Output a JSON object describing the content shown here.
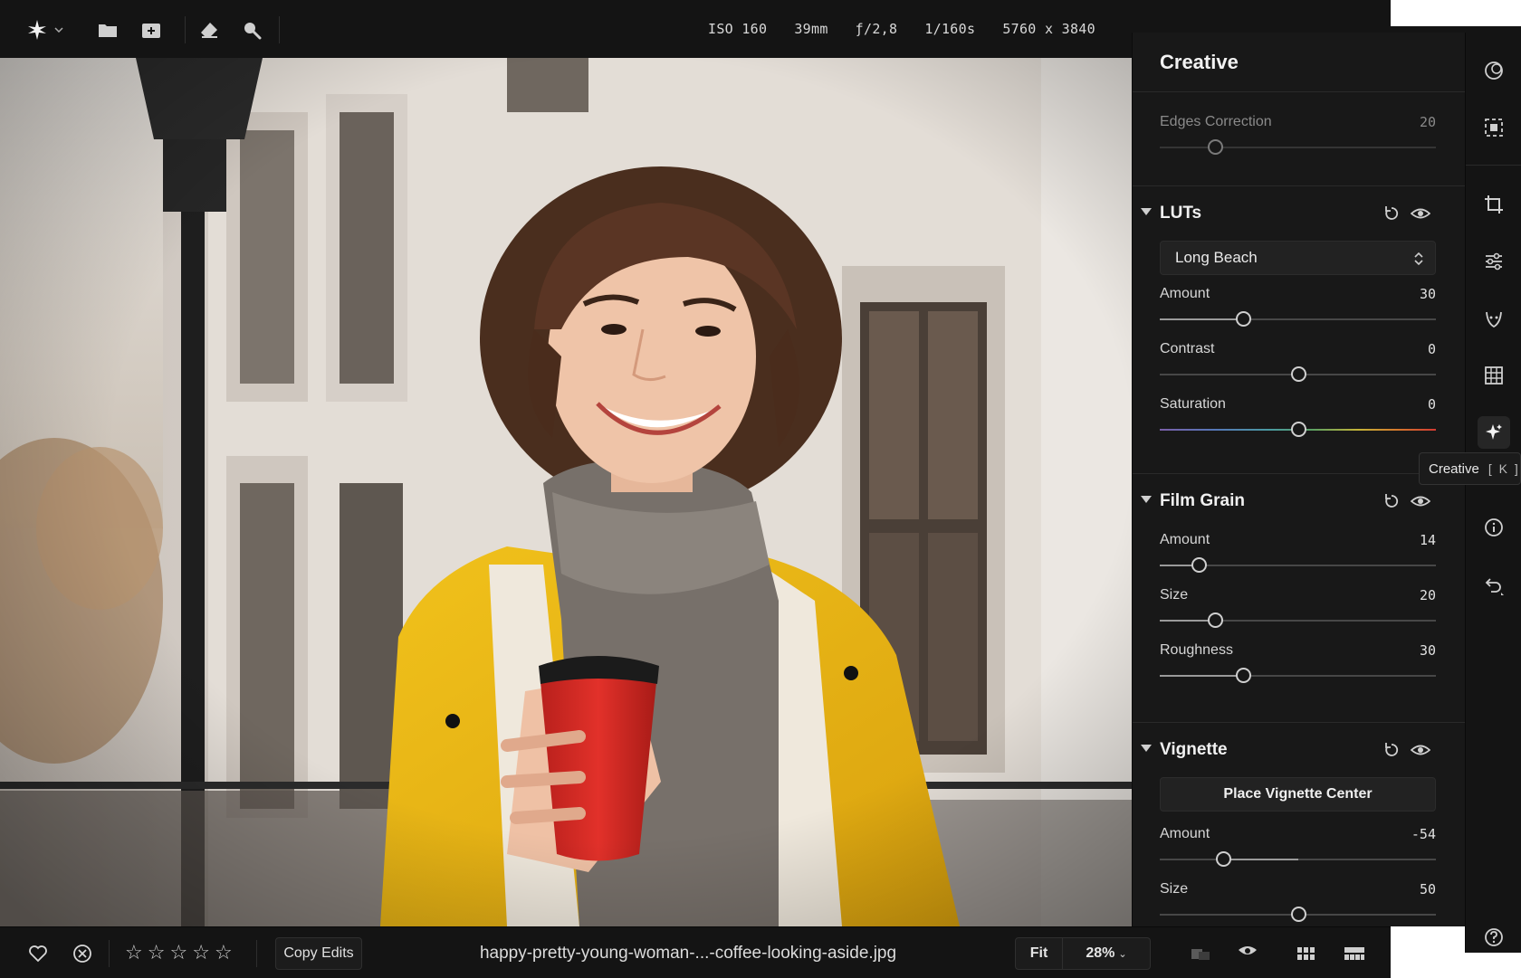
{
  "toolbar": {
    "icons": [
      "app-logo-sparkle-icon",
      "chevron-down-icon",
      "folder-icon",
      "add-image-icon",
      "eraser-icon",
      "zoom-icon"
    ],
    "exif": {
      "iso": "ISO 160",
      "focal": "39mm",
      "aperture": "ƒ/2,8",
      "shutter": "1/160s",
      "dimensions": "5760 x 3840"
    }
  },
  "panel": {
    "title": "Creative",
    "edges": {
      "label": "Edges Correction",
      "value": "20",
      "level": 0.2
    },
    "luts": {
      "title": "LUTs",
      "preset": "Long Beach",
      "sliders": [
        {
          "label": "Amount",
          "value": "30",
          "level": 0.3
        },
        {
          "label": "Contrast",
          "value": "0",
          "level": 0.5
        },
        {
          "label": "Saturation",
          "value": "0",
          "level": 0.5
        }
      ]
    },
    "film_grain": {
      "title": "Film Grain",
      "sliders": [
        {
          "label": "Amount",
          "value": "14",
          "level": 0.14
        },
        {
          "label": "Size",
          "value": "20",
          "level": 0.2
        },
        {
          "label": "Roughness",
          "value": "30",
          "level": 0.3
        }
      ]
    },
    "vignette": {
      "title": "Vignette",
      "button": "Place Vignette Center",
      "sliders": [
        {
          "label": "Amount",
          "value": "-54",
          "level": 0.23
        },
        {
          "label": "Size",
          "value": "50",
          "level": 0.5
        }
      ]
    }
  },
  "rail": {
    "icons": [
      "overlays-icon",
      "masking-icon",
      "crop-icon",
      "adjust-sliders-icon",
      "portrait-icon",
      "structure-grid-icon",
      "creative-sparkle-icon",
      "info-icon",
      "undo-history-icon",
      "help-icon"
    ],
    "active": "creative-sparkle-icon",
    "tooltip": {
      "label": "Creative",
      "shortcut": "[ K ]"
    }
  },
  "bottom": {
    "copy_edits": "Copy Edits",
    "filename": "happy-pretty-young-woman-...-coffee-looking-aside.jpg",
    "zoom_fit": "Fit",
    "zoom_value": "28%",
    "rating": 0,
    "icons": [
      "favorite-heart-icon",
      "reject-icon",
      "compare-icon",
      "preview-eye-icon",
      "grid-view-icon",
      "filmstrip-icon"
    ]
  }
}
